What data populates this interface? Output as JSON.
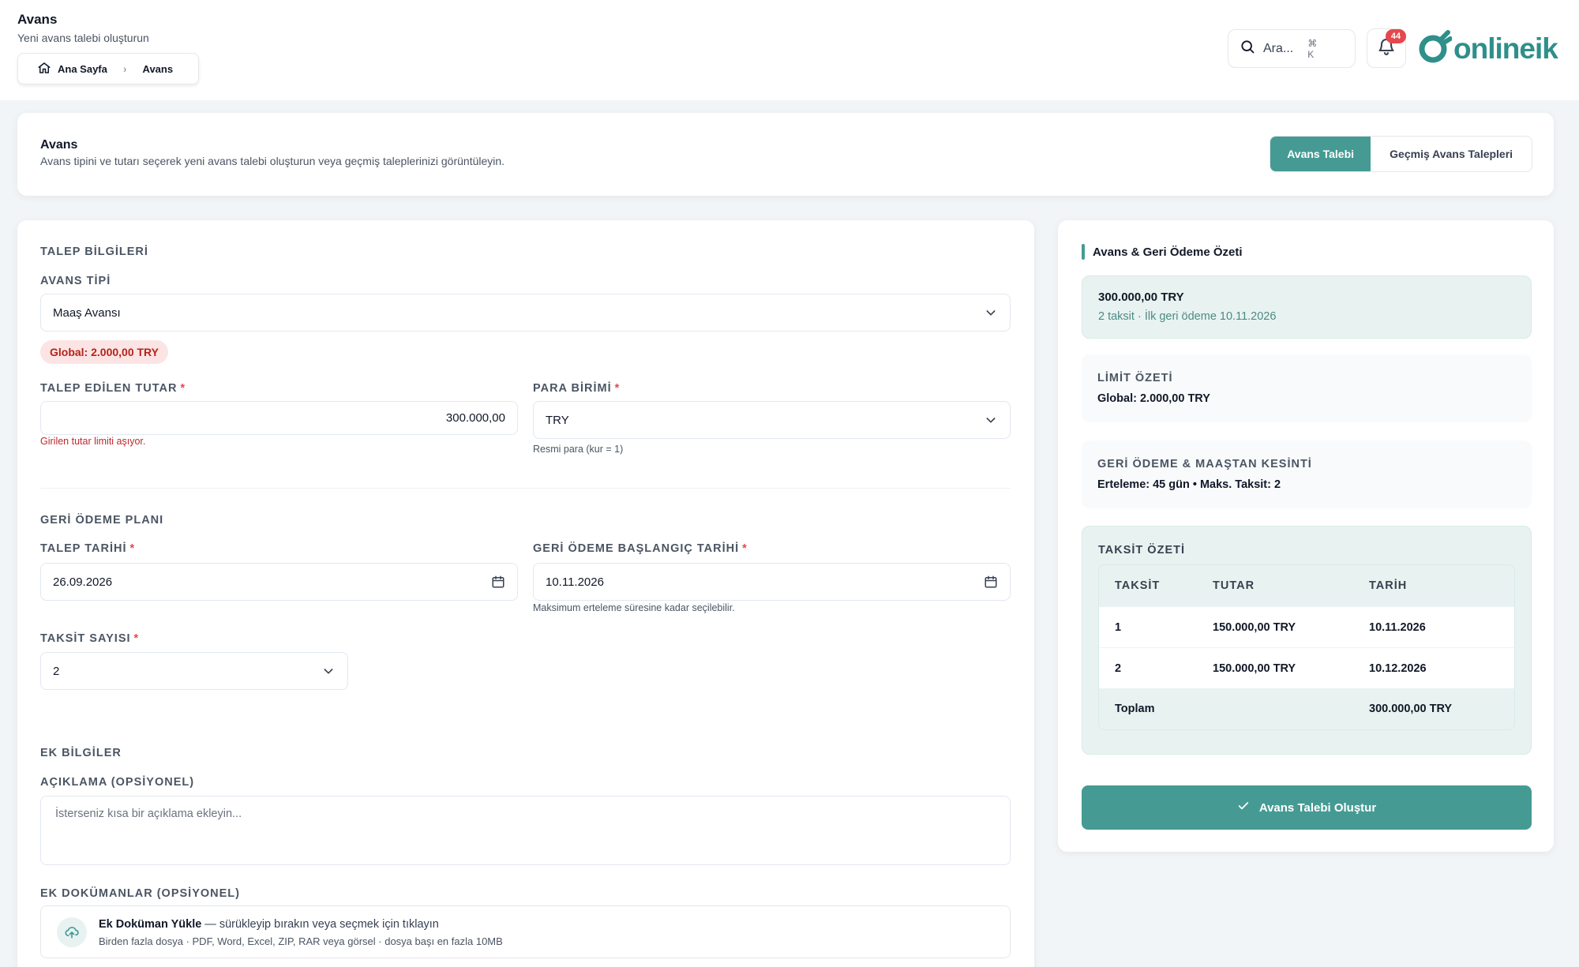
{
  "header": {
    "title": "Avans",
    "subtitle": "Yeni avans talebi oluşturun",
    "breadcrumb": {
      "home": "Ana Sayfa",
      "current": "Avans"
    },
    "search": {
      "placeholder": "Ara...",
      "shortcut": "⌘ K"
    },
    "notifications": {
      "count": "44"
    },
    "logo": {
      "text": "onlineik",
      "mark": "O"
    },
    "brand_color": "#459b94"
  },
  "intro": {
    "title": "Avans",
    "description": "Avans tipini ve tutarı seçerek yeni avans talebi oluşturun veya geçmiş taleplerinizi görüntüleyin.",
    "tabs": [
      {
        "label": "Avans Talebi",
        "active": true
      },
      {
        "label": "Geçmiş Avans Talepleri",
        "active": false
      }
    ]
  },
  "form": {
    "request_section": "TALEP BİLGİLERİ",
    "advance_type": {
      "label": "AVANS TİPİ",
      "value": "Maaş Avansı",
      "limit_badge": "Global: 2.000,00 TRY"
    },
    "amount": {
      "label": "TALEP EDİLEN TUTAR",
      "value": "300.000,00",
      "error": "Girilen tutar limiti aşıyor."
    },
    "currency": {
      "label": "PARA BİRİMİ",
      "value": "TRY",
      "hint": "Resmi para (kur = 1)"
    },
    "repayment_section": "GERİ ÖDEME PLANI",
    "request_date": {
      "label": "TALEP TARİHİ",
      "value": "26.09.2026"
    },
    "repayment_start": {
      "label": "GERİ ÖDEME BAŞLANGIÇ TARİHİ",
      "value": "10.11.2026",
      "hint": "Maksimum erteleme süresine kadar seçilebilir."
    },
    "installments": {
      "label": "TAKSİT SAYISI",
      "value": "2"
    },
    "extra_section": "EK BİLGİLER",
    "description": {
      "label": "AÇIKLAMA (OPSİYONEL)",
      "placeholder": "İsterseniz kısa bir açıklama ekleyin..."
    },
    "documents": {
      "label": "EK DOKÜMANLAR (OPSİYONEL)",
      "title_bold": "Ek Doküman Yükle",
      "title_rest": " — sürükleyip bırakın veya seçmek için tıklayın",
      "subtitle": "Birden fazla dosya · PDF, Word, Excel, ZIP, RAR veya görsel · dosya başı en fazla 10MB"
    }
  },
  "summary": {
    "title": "Avans & Geri Ödeme Özeti",
    "amount": "300.000,00 TRY",
    "amount_sub": "2 taksit · İlk geri ödeme 10.11.2026",
    "limit": {
      "title": "LİMİT ÖZETİ",
      "value": "Global: 2.000,00 TRY"
    },
    "repayment": {
      "title": "GERİ ÖDEME & MAAŞTAN KESİNTİ",
      "value": "Erteleme: 45 gün • Maks. Taksit: 2"
    },
    "installments": {
      "title": "TAKSİT ÖZETİ",
      "columns": [
        "TAKSİT",
        "TUTAR",
        "TARİH"
      ],
      "rows": [
        [
          "1",
          "150.000,00 TRY",
          "10.11.2026"
        ],
        [
          "2",
          "150.000,00 TRY",
          "10.12.2026"
        ]
      ],
      "total_label": "Toplam",
      "total_value": "300.000,00 TRY"
    },
    "submit": "Avans Talebi Oluştur"
  }
}
